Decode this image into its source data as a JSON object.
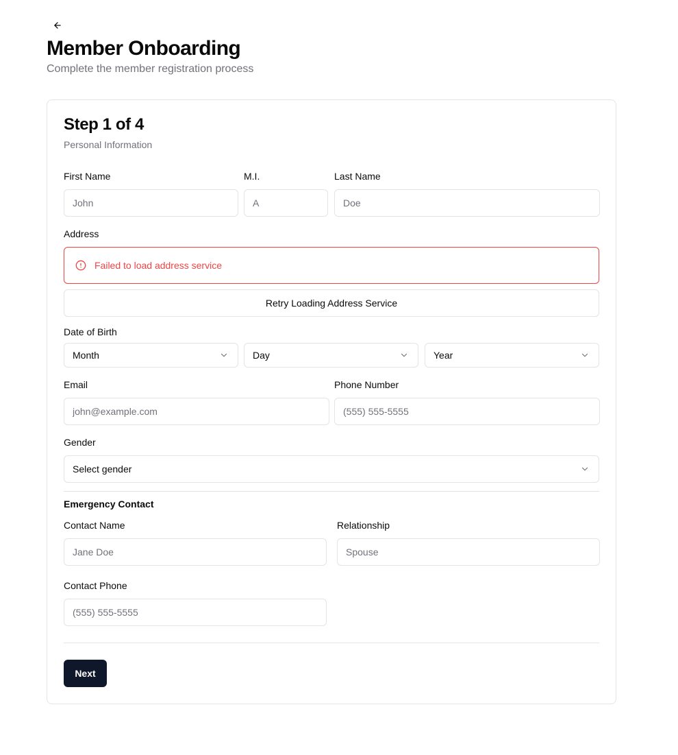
{
  "header": {
    "back_icon": "arrow-left-icon",
    "title": "Member Onboarding",
    "subtitle": "Complete the member registration process"
  },
  "step": {
    "title": "Step 1 of 4",
    "subtitle": "Personal Information"
  },
  "fields": {
    "first_name": {
      "label": "First Name",
      "placeholder": "John"
    },
    "middle_initial": {
      "label": "M.I.",
      "placeholder": "A"
    },
    "last_name": {
      "label": "Last Name",
      "placeholder": "Doe"
    },
    "address": {
      "label": "Address"
    },
    "date_of_birth": {
      "label": "Date of Birth",
      "month": "Month",
      "day": "Day",
      "year": "Year"
    },
    "email": {
      "label": "Email",
      "placeholder": "john@example.com"
    },
    "phone": {
      "label": "Phone Number",
      "placeholder": "(555) 555-5555"
    },
    "gender": {
      "label": "Gender",
      "value": "Select gender"
    }
  },
  "address_alert": {
    "icon": "alert-circle-icon",
    "message": "Failed to load address service",
    "retry_label": "Retry Loading Address Service"
  },
  "emergency": {
    "title": "Emergency Contact",
    "contact_name": {
      "label": "Contact Name",
      "placeholder": "Jane Doe"
    },
    "relationship": {
      "label": "Relationship",
      "placeholder": "Spouse"
    },
    "contact_phone": {
      "label": "Contact Phone",
      "placeholder": "(555) 555-5555"
    }
  },
  "actions": {
    "next_label": "Next"
  },
  "colors": {
    "primary": "#0f172a",
    "error": "#ef4444",
    "border": "#e4e4e7",
    "muted_text": "#71717a"
  }
}
